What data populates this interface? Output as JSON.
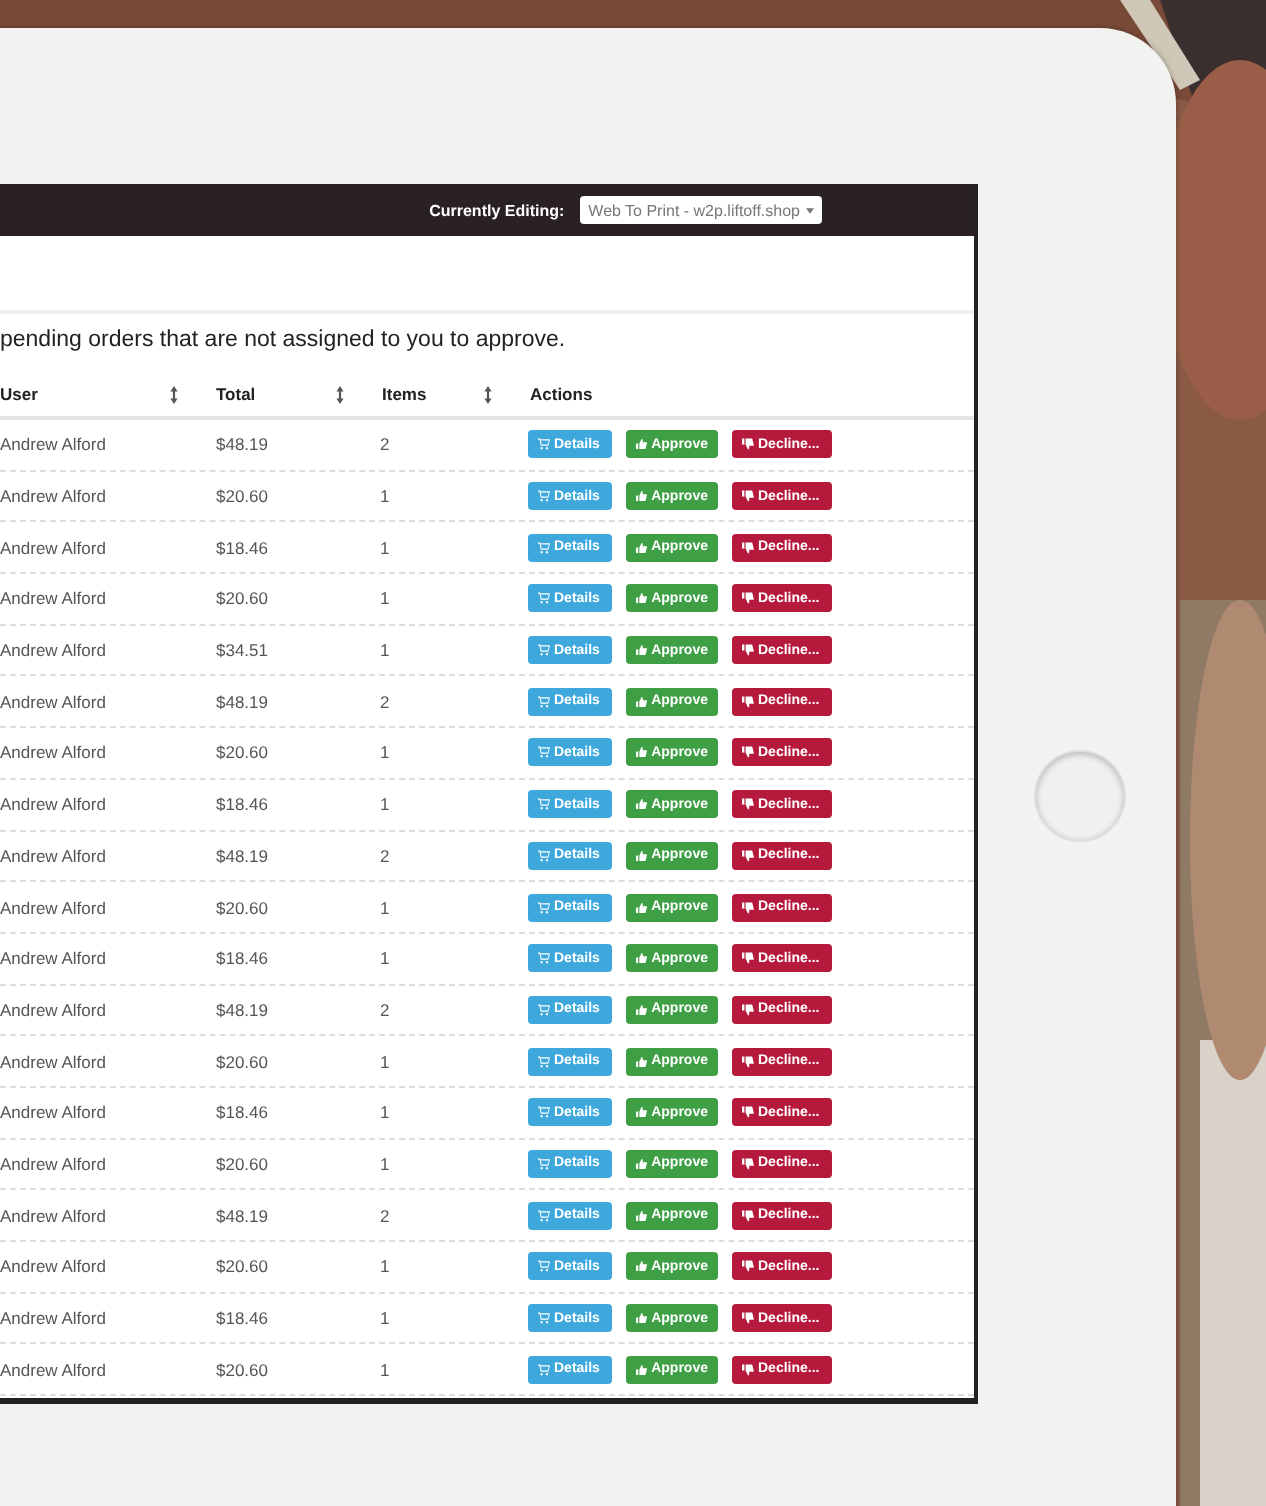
{
  "header": {
    "label": "Currently Editing:",
    "select_value": "Web To Print - w2p.liftoff.shop"
  },
  "intro": "pending orders that are not assigned to you to approve.",
  "table": {
    "columns": [
      "User",
      "Total",
      "Items",
      "Actions"
    ],
    "rows": [
      {
        "user": "Andrew Alford",
        "total": "$48.19",
        "items": "2",
        "actions": [
          {
            "kind": "details",
            "label": "Details"
          },
          {
            "kind": "approve",
            "label": "Approve"
          },
          {
            "kind": "decline",
            "label": "Decline..."
          }
        ]
      },
      {
        "user": "Andrew Alford",
        "total": "$20.60",
        "items": "1",
        "actions": [
          {
            "kind": "details",
            "label": "Details"
          },
          {
            "kind": "approve",
            "label": "Approve"
          },
          {
            "kind": "decline",
            "label": "Decline..."
          }
        ]
      },
      {
        "user": "Andrew Alford",
        "total": "$18.46",
        "items": "1",
        "actions": [
          {
            "kind": "details",
            "label": "Details"
          },
          {
            "kind": "approve",
            "label": "Approve"
          },
          {
            "kind": "decline",
            "label": "Decline..."
          }
        ]
      },
      {
        "user": "Andrew Alford",
        "total": "$20.60",
        "items": "1",
        "actions": [
          {
            "kind": "details",
            "label": "Details"
          },
          {
            "kind": "approve",
            "label": "Approve"
          },
          {
            "kind": "decline",
            "label": "Decline..."
          }
        ]
      },
      {
        "user": "Andrew Alford",
        "total": "$34.51",
        "items": "1",
        "actions": [
          {
            "kind": "details",
            "label": "Details"
          },
          {
            "kind": "approve",
            "label": "Approve"
          },
          {
            "kind": "decline",
            "label": "Decline..."
          }
        ]
      },
      {
        "user": "Andrew Alford",
        "total": "$48.19",
        "items": "2",
        "actions": [
          {
            "kind": "details",
            "label": "Details"
          },
          {
            "kind": "approve",
            "label": "Approve"
          },
          {
            "kind": "decline",
            "label": "Decline..."
          }
        ]
      },
      {
        "user": "Andrew Alford",
        "total": "$20.60",
        "items": "1",
        "actions": [
          {
            "kind": "details",
            "label": "Details"
          },
          {
            "kind": "approve",
            "label": "Approve"
          },
          {
            "kind": "decline",
            "label": "Decline..."
          }
        ]
      },
      {
        "user": "Andrew Alford",
        "total": "$18.46",
        "items": "1",
        "actions": [
          {
            "kind": "details",
            "label": "Details"
          },
          {
            "kind": "approve",
            "label": "Approve"
          },
          {
            "kind": "decline",
            "label": "Decline..."
          }
        ]
      },
      {
        "user": "Andrew Alford",
        "total": "$48.19",
        "items": "2",
        "actions": [
          {
            "kind": "details",
            "label": "Details"
          },
          {
            "kind": "approve",
            "label": "Approve"
          },
          {
            "kind": "decline",
            "label": "Decline..."
          }
        ]
      },
      {
        "user": "Andrew Alford",
        "total": "$20.60",
        "items": "1",
        "actions": [
          {
            "kind": "details",
            "label": "Details"
          },
          {
            "kind": "approve",
            "label": "Approve"
          },
          {
            "kind": "decline",
            "label": "Decline..."
          }
        ]
      },
      {
        "user": "Andrew Alford",
        "total": "$18.46",
        "items": "1",
        "actions": [
          {
            "kind": "details",
            "label": "Details"
          },
          {
            "kind": "approve",
            "label": "Approve"
          },
          {
            "kind": "decline",
            "label": "Decline..."
          }
        ]
      },
      {
        "user": "Andrew Alford",
        "total": "$48.19",
        "items": "2",
        "actions": [
          {
            "kind": "details",
            "label": "Details"
          },
          {
            "kind": "approve",
            "label": "Approve"
          },
          {
            "kind": "decline",
            "label": "Decline..."
          }
        ]
      },
      {
        "user": "Andrew Alford",
        "total": "$20.60",
        "items": "1",
        "actions": [
          {
            "kind": "details",
            "label": "Details"
          },
          {
            "kind": "approve",
            "label": "Approve"
          },
          {
            "kind": "decline",
            "label": "Decline..."
          }
        ]
      },
      {
        "user": "Andrew Alford",
        "total": "$18.46",
        "items": "1",
        "actions": [
          {
            "kind": "details",
            "label": "Details"
          },
          {
            "kind": "approve",
            "label": "Approve"
          },
          {
            "kind": "decline",
            "label": "Decline..."
          }
        ]
      },
      {
        "user": "Andrew Alford",
        "total": "$20.60",
        "items": "1",
        "actions": [
          {
            "kind": "details",
            "label": "Details"
          },
          {
            "kind": "approve",
            "label": "Approve"
          },
          {
            "kind": "decline",
            "label": "Decline..."
          }
        ]
      },
      {
        "user": "Andrew Alford",
        "total": "$48.19",
        "items": "2",
        "actions": [
          {
            "kind": "details",
            "label": "Details"
          },
          {
            "kind": "approve",
            "label": "Approve"
          },
          {
            "kind": "decline",
            "label": "Decline..."
          }
        ]
      },
      {
        "user": "Andrew Alford",
        "total": "$20.60",
        "items": "1",
        "actions": [
          {
            "kind": "details",
            "label": "Details"
          },
          {
            "kind": "approve",
            "label": "Approve"
          },
          {
            "kind": "decline",
            "label": "Decline..."
          }
        ]
      },
      {
        "user": "Andrew Alford",
        "total": "$18.46",
        "items": "1",
        "actions": [
          {
            "kind": "details",
            "label": "Details"
          },
          {
            "kind": "approve",
            "label": "Approve"
          },
          {
            "kind": "decline",
            "label": "Decline..."
          }
        ]
      },
      {
        "user": "Andrew Alford",
        "total": "$20.60",
        "items": "1",
        "actions": [
          {
            "kind": "details",
            "label": "Details"
          },
          {
            "kind": "approve",
            "label": "Approve"
          },
          {
            "kind": "decline",
            "label": "Decline..."
          }
        ]
      }
    ]
  }
}
